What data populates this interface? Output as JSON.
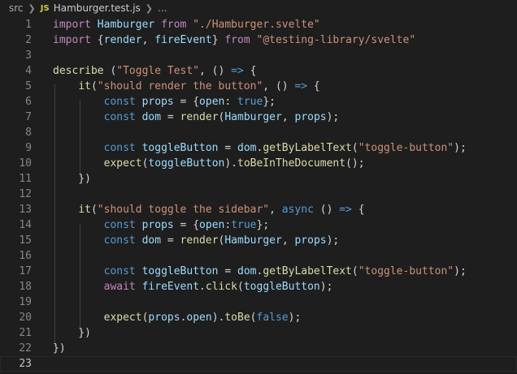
{
  "breadcrumb": {
    "folder": "src",
    "file_icon": "JS",
    "file": "Hamburger.test.js",
    "trail": "..."
  },
  "editor": {
    "current_line": 23,
    "lines": [
      {
        "n": "1",
        "tokens": [
          [
            "k",
            "import"
          ],
          [
            "p",
            " "
          ],
          [
            "v",
            "Hamburger"
          ],
          [
            "p",
            " "
          ],
          [
            "k",
            "from"
          ],
          [
            "p",
            " "
          ],
          [
            "s",
            "\"./Hamburger.svelte\""
          ]
        ]
      },
      {
        "n": "2",
        "tokens": [
          [
            "k",
            "import"
          ],
          [
            "p",
            " {"
          ],
          [
            "v",
            "render"
          ],
          [
            "p",
            ", "
          ],
          [
            "v",
            "fireEvent"
          ],
          [
            "p",
            "} "
          ],
          [
            "k",
            "from"
          ],
          [
            "p",
            " "
          ],
          [
            "s",
            "\"@testing-library/svelte\""
          ]
        ]
      },
      {
        "n": "3",
        "tokens": []
      },
      {
        "n": "4",
        "tokens": [
          [
            "f",
            "describe"
          ],
          [
            "p",
            " ("
          ],
          [
            "s",
            "\"Toggle Test\""
          ],
          [
            "p",
            ", () "
          ],
          [
            "kw",
            "=>"
          ],
          [
            "p",
            " {"
          ]
        ]
      },
      {
        "n": "5",
        "tokens": [
          [
            "p",
            "    "
          ],
          [
            "f",
            "it"
          ],
          [
            "p",
            "("
          ],
          [
            "s",
            "\"should render the button\""
          ],
          [
            "p",
            ", () "
          ],
          [
            "kw",
            "=>"
          ],
          [
            "p",
            " {"
          ]
        ]
      },
      {
        "n": "6",
        "tokens": [
          [
            "p",
            "        "
          ],
          [
            "kw",
            "const"
          ],
          [
            "p",
            " "
          ],
          [
            "v",
            "props"
          ],
          [
            "p",
            " = {"
          ],
          [
            "v",
            "open"
          ],
          [
            "p",
            ": "
          ],
          [
            "kw",
            "true"
          ],
          [
            "p",
            "};"
          ]
        ]
      },
      {
        "n": "7",
        "tokens": [
          [
            "p",
            "        "
          ],
          [
            "kw",
            "const"
          ],
          [
            "p",
            " "
          ],
          [
            "v",
            "dom"
          ],
          [
            "p",
            " = "
          ],
          [
            "f",
            "render"
          ],
          [
            "p",
            "("
          ],
          [
            "v",
            "Hamburger"
          ],
          [
            "p",
            ", "
          ],
          [
            "v",
            "props"
          ],
          [
            "p",
            ");"
          ]
        ]
      },
      {
        "n": "8",
        "tokens": []
      },
      {
        "n": "9",
        "tokens": [
          [
            "p",
            "        "
          ],
          [
            "kw",
            "const"
          ],
          [
            "p",
            " "
          ],
          [
            "v",
            "toggleButton"
          ],
          [
            "p",
            " = "
          ],
          [
            "v",
            "dom"
          ],
          [
            "p",
            "."
          ],
          [
            "f",
            "getByLabelText"
          ],
          [
            "p",
            "("
          ],
          [
            "s",
            "\"toggle-button\""
          ],
          [
            "p",
            ");"
          ]
        ]
      },
      {
        "n": "10",
        "tokens": [
          [
            "p",
            "        "
          ],
          [
            "f",
            "expect"
          ],
          [
            "p",
            "("
          ],
          [
            "v",
            "toggleButton"
          ],
          [
            "p",
            ")."
          ],
          [
            "f",
            "toBeInTheDocument"
          ],
          [
            "p",
            "();"
          ]
        ]
      },
      {
        "n": "11",
        "tokens": [
          [
            "p",
            "    })"
          ]
        ]
      },
      {
        "n": "12",
        "tokens": []
      },
      {
        "n": "13",
        "tokens": [
          [
            "p",
            "    "
          ],
          [
            "f",
            "it"
          ],
          [
            "p",
            "("
          ],
          [
            "s",
            "\"should toggle the sidebar\""
          ],
          [
            "p",
            ", "
          ],
          [
            "kw",
            "async"
          ],
          [
            "p",
            " () "
          ],
          [
            "kw",
            "=>"
          ],
          [
            "p",
            " {"
          ]
        ]
      },
      {
        "n": "14",
        "tokens": [
          [
            "p",
            "        "
          ],
          [
            "kw",
            "const"
          ],
          [
            "p",
            " "
          ],
          [
            "v",
            "props"
          ],
          [
            "p",
            " = {"
          ],
          [
            "v",
            "open"
          ],
          [
            "p",
            ":"
          ],
          [
            "kw",
            "true"
          ],
          [
            "p",
            "};"
          ]
        ]
      },
      {
        "n": "15",
        "tokens": [
          [
            "p",
            "        "
          ],
          [
            "kw",
            "const"
          ],
          [
            "p",
            " "
          ],
          [
            "v",
            "dom"
          ],
          [
            "p",
            " = "
          ],
          [
            "f",
            "render"
          ],
          [
            "p",
            "("
          ],
          [
            "v",
            "Hamburger"
          ],
          [
            "p",
            ", "
          ],
          [
            "v",
            "props"
          ],
          [
            "p",
            ");"
          ]
        ]
      },
      {
        "n": "16",
        "tokens": []
      },
      {
        "n": "17",
        "tokens": [
          [
            "p",
            "        "
          ],
          [
            "kw",
            "const"
          ],
          [
            "p",
            " "
          ],
          [
            "v",
            "toggleButton"
          ],
          [
            "p",
            " = "
          ],
          [
            "v",
            "dom"
          ],
          [
            "p",
            "."
          ],
          [
            "f",
            "getByLabelText"
          ],
          [
            "p",
            "("
          ],
          [
            "s",
            "\"toggle-button\""
          ],
          [
            "p",
            ");"
          ]
        ]
      },
      {
        "n": "18",
        "tokens": [
          [
            "p",
            "        "
          ],
          [
            "k",
            "await"
          ],
          [
            "p",
            " "
          ],
          [
            "v",
            "fireEvent"
          ],
          [
            "p",
            "."
          ],
          [
            "f",
            "click"
          ],
          [
            "p",
            "("
          ],
          [
            "v",
            "toggleButton"
          ],
          [
            "p",
            ");"
          ]
        ]
      },
      {
        "n": "19",
        "tokens": []
      },
      {
        "n": "20",
        "tokens": [
          [
            "p",
            "        "
          ],
          [
            "f",
            "expect"
          ],
          [
            "p",
            "("
          ],
          [
            "v",
            "props"
          ],
          [
            "p",
            "."
          ],
          [
            "v",
            "open"
          ],
          [
            "p",
            ")."
          ],
          [
            "f",
            "toBe"
          ],
          [
            "p",
            "("
          ],
          [
            "kw",
            "false"
          ],
          [
            "p",
            ");"
          ]
        ]
      },
      {
        "n": "21",
        "tokens": [
          [
            "p",
            "    })"
          ]
        ]
      },
      {
        "n": "22",
        "tokens": [
          [
            "p",
            "})"
          ]
        ]
      },
      {
        "n": "23",
        "tokens": []
      }
    ]
  }
}
